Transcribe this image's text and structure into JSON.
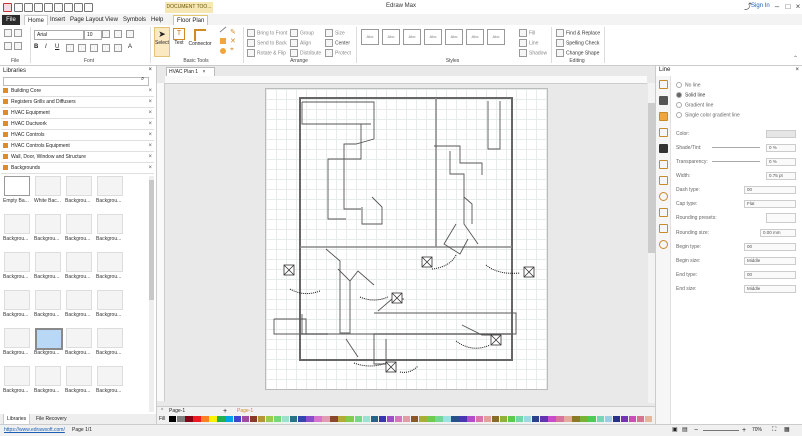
{
  "app": {
    "title": "Edraw Max",
    "login": "Sign In"
  },
  "menu_tabs": [
    "File",
    "Home",
    "Insert",
    "Page Layout",
    "View",
    "Symbols",
    "Help"
  ],
  "context_tab": {
    "group": "DOCUMENT TOO...",
    "tab": "Floor Plan"
  },
  "ribbon": {
    "font_name": "Arial",
    "font_size": "10",
    "select": "Select",
    "text": "Text",
    "connector": "Connector",
    "bring_front": "Bring to Front",
    "send_back": "Send to Back",
    "rotate_flip": "Rotate & Flip",
    "group": "Group",
    "align": "Align",
    "distribute": "Distribute",
    "size": "Size",
    "center": "Center",
    "protect": "Protect",
    "style_box": "Abc",
    "fill": "Fill",
    "line": "Line",
    "shadow": "Shadow",
    "find_replace": "Find & Replace",
    "spelling": "Spelling Check",
    "change_shape": "Change Shape",
    "groups": [
      "File",
      "Font",
      "Basic Tools",
      "Arrange",
      "Styles",
      "Editing"
    ]
  },
  "libraries": {
    "title": "Libraries",
    "items": [
      "Building Core",
      "Registers Grills and Diffusers",
      "HVAC Equipment",
      "HVAC Ductwork",
      "HVAC Controls",
      "HVAC Controls Equipment",
      "Wall, Door, Window and Structure",
      "Backgrounds"
    ],
    "thumbs": [
      "Empty Ba...",
      "White Bac...",
      "Backgrou...",
      "Backgrou...",
      "Backgrou...",
      "Backgrou...",
      "Backgrou...",
      "Backgrou...",
      "Backgrou...",
      "Backgrou...",
      "Backgrou...",
      "Backgrou...",
      "Backgrou...",
      "Backgrou...",
      "Backgrou...",
      "Backgrou...",
      "Backgrou...",
      "Backgrou...",
      "Backgrou...",
      "Backgrou...",
      "Backgrou...",
      "Backgrou...",
      "Backgrou...",
      "Backgrou..."
    ],
    "bottom_tabs": [
      "Libraries",
      "File Recovery"
    ]
  },
  "document": {
    "tab": "HVAC Plan 1",
    "page_name": "Page-1",
    "page_tab": "Page-1",
    "fill_label": "Fill"
  },
  "line_panel": {
    "title": "Line",
    "options": [
      "No line",
      "Solid line",
      "Gradient line",
      "Single color gradient line"
    ],
    "props": [
      {
        "label": "Color:",
        "value": ""
      },
      {
        "label": "Shade/Tint:",
        "value": "0 %"
      },
      {
        "label": "Transparency:",
        "value": "0 %"
      },
      {
        "label": "Width:",
        "value": "0.75 pt"
      },
      {
        "label": "Dash type:",
        "value": "00"
      },
      {
        "label": "Cap type:",
        "value": "Flat"
      },
      {
        "label": "Rounding presets:",
        "value": ""
      },
      {
        "label": "Rounding size:",
        "value": "0.00 mm"
      },
      {
        "label": "Begin type:",
        "value": "00"
      },
      {
        "label": "Begin size:",
        "value": "Middle"
      },
      {
        "label": "End type:",
        "value": "00"
      },
      {
        "label": "End size:",
        "value": "Middle"
      }
    ]
  },
  "status": {
    "url": "https://www.edrawsoft.com/",
    "page": "Page 1/1",
    "zoom": "70%"
  }
}
